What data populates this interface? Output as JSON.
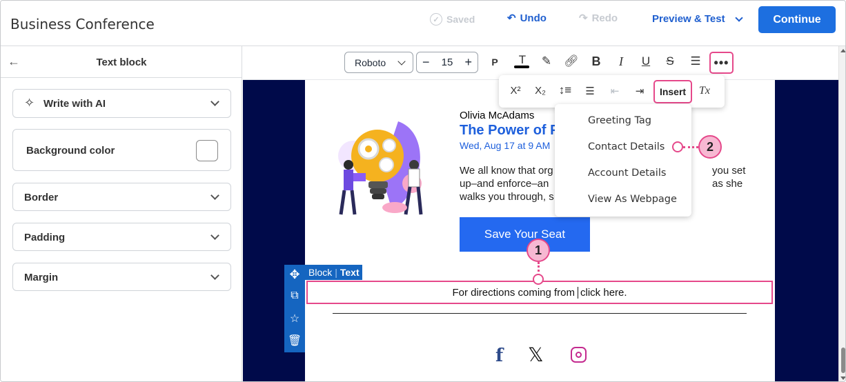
{
  "header": {
    "title": "Business Conference",
    "saved_label": "Saved",
    "undo_label": "Undo",
    "redo_label": "Redo",
    "preview_label": "Preview & Test",
    "continue_label": "Continue"
  },
  "sidebar": {
    "title": "Text block",
    "ai_label": "Write with AI",
    "background_label": "Background color",
    "border_label": "Border",
    "padding_label": "Padding",
    "margin_label": "Margin"
  },
  "toolbar": {
    "font": "Roboto",
    "size": "15",
    "paragraph_label": "P"
  },
  "more_menu": {
    "superscript": "X²",
    "subscript": "X₂",
    "insert_label": "Insert",
    "clear_format": "Tx"
  },
  "insert_menu": {
    "items": [
      "Greeting Tag",
      "Contact Details",
      "Account Details",
      "View As Webpage"
    ]
  },
  "email": {
    "speaker": "Olivia McAdams",
    "title": "The Power of P",
    "date": "Wed, Aug 17 at 9 AM",
    "body_lines": [
      "We all know that org",
      "up–and enforce–an",
      "walks you through, s"
    ],
    "body_right": [
      "you set",
      "as she"
    ],
    "cta": "Save Your Seat",
    "directions_before": "For directions coming from",
    "directions_after": "click here."
  },
  "block_label": {
    "block": "Block",
    "text": "Text"
  },
  "callouts": [
    "1",
    "2"
  ],
  "colors": {
    "accent": "#1d6fe0",
    "highlight": "#e5488a",
    "canvas_bg": "#000a4a"
  }
}
